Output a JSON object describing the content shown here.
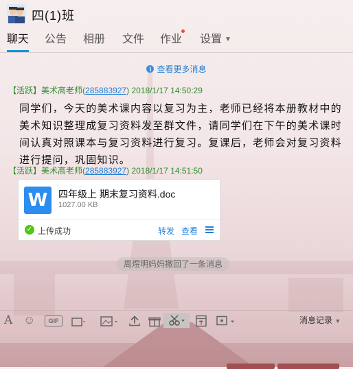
{
  "window": {
    "title": "四(1)班"
  },
  "tabs": [
    {
      "label": "聊天",
      "active": true
    },
    {
      "label": "公告"
    },
    {
      "label": "相册"
    },
    {
      "label": "文件"
    },
    {
      "label": "作业",
      "has_dot": true
    },
    {
      "label": "设置",
      "has_caret": true
    }
  ],
  "chat": {
    "more_messages": "查看更多消息",
    "messages": [
      {
        "tag": "【活跃】",
        "sender": "美术高老师",
        "qq": "285883927",
        "time": "2018/1/17 14:50:29",
        "text": "同学们，今天的美术课内容以复习为主，老师已经将本册教材中的美术知识整理成复习资料发至群文件，请同学们在下午的美术课时间认真对照课本与复习资料进行复习。复课后，老师会对复习资料进行提问，巩固知识。"
      },
      {
        "tag": "【活跃】",
        "sender": "美术高老师",
        "qq": "285883927",
        "time": "2018/1/17 14:51:50",
        "file": {
          "name": "四年级上 期末复习资料.doc",
          "size": "1027.00 KB",
          "status": "上传成功",
          "forward": "转发",
          "view": "查看"
        }
      }
    ],
    "system_notice": "周煜明妈妈撤回了一条消息"
  },
  "toolbar": {
    "history_label": "消息记录"
  },
  "colors": {
    "accent": "#1296db",
    "link": "#1f7fd6",
    "sender_green": "#2f8d2f",
    "success": "#52c41a"
  }
}
